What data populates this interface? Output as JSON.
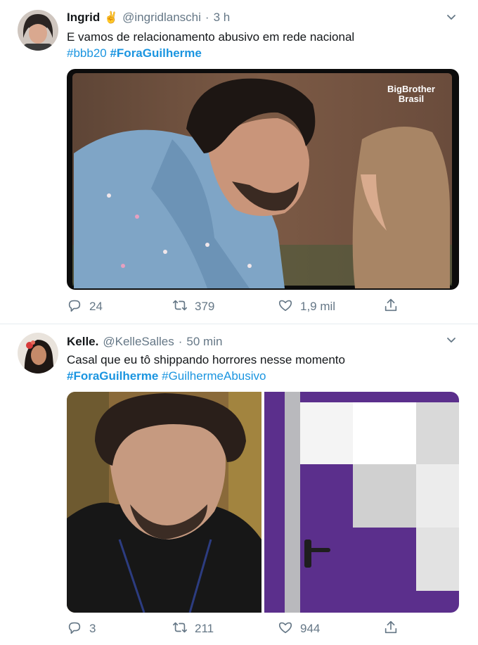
{
  "tweets": [
    {
      "name": "Ingrid",
      "emoji": "✌",
      "handle": "@ingridlanschi",
      "separator": "·",
      "time": "3 h",
      "text": "E vamos de relacionamento abusivo em rede nacional",
      "hashtags": [
        "#bbb20",
        "#ForaGuilherme"
      ],
      "media_logo": "BigBrother Brasil",
      "stats": {
        "replies": "24",
        "retweets": "379",
        "likes": "1,9 mil"
      }
    },
    {
      "name": "Kelle.",
      "handle": "@KelleSalles",
      "separator": "·",
      "time": "50 min",
      "text": "Casal que eu tô shippando horrores nesse momento",
      "hashtags": [
        "#ForaGuilherme",
        "#GuilhermeAbusivo"
      ],
      "stats": {
        "replies": "3",
        "retweets": "211",
        "likes": "944"
      }
    }
  ],
  "icons": [
    "chevron-down-icon",
    "reply-icon",
    "retweet-icon",
    "like-icon",
    "share-icon"
  ],
  "colors": {
    "link": "#1b95e0",
    "muted": "#657786",
    "text": "#14171a",
    "border": "#e6ecf0"
  }
}
